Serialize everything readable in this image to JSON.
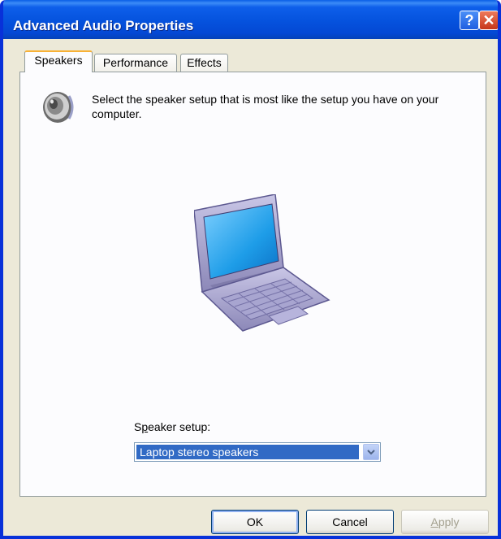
{
  "window": {
    "title": "Advanced Audio Properties"
  },
  "titlebar": {
    "help_label": "?",
    "close_label": "✕"
  },
  "tabs": [
    {
      "label": "Speakers",
      "active": true
    },
    {
      "label": "Performance",
      "active": false
    },
    {
      "label": "Effects",
      "active": false
    }
  ],
  "panel": {
    "instruction": "Select the speaker setup that is most like the setup you have on your computer.",
    "speaker_setup": {
      "label_prefix": "S",
      "label_accel": "p",
      "label_rest": "eaker setup:",
      "value": "Laptop stereo speakers"
    }
  },
  "buttons": {
    "ok": "OK",
    "cancel": "Cancel",
    "apply_accel": "A",
    "apply_rest": "pply"
  },
  "colors": {
    "titlebar": "#0552dd",
    "selection": "#316ac5",
    "tab_highlight": "#f8b135"
  }
}
